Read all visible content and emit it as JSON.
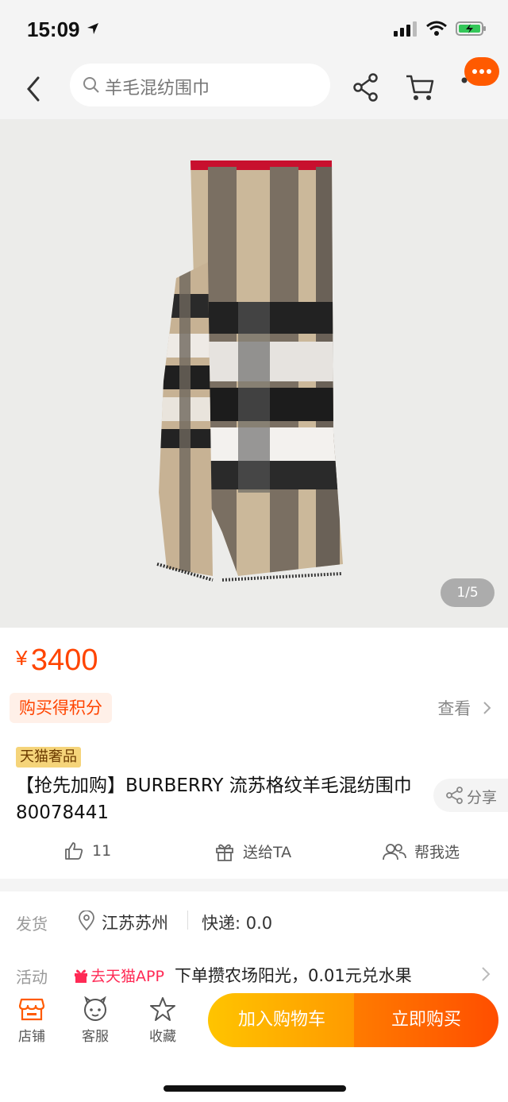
{
  "status": {
    "time": "15:09"
  },
  "search": {
    "query": "羊毛混纺围巾"
  },
  "gallery": {
    "counter": "1/5"
  },
  "price": {
    "currency": "¥",
    "amount": "3400"
  },
  "points": {
    "label": "购买得积分",
    "view": "查看"
  },
  "product": {
    "tag": "天猫奢品",
    "title": "【抢先加购】BURBERRY 流苏格纹羊毛混纺围巾 80078441",
    "share": "分享"
  },
  "actions": {
    "likes": "11",
    "gift": "送给TA",
    "help": "帮我选"
  },
  "shipping": {
    "label": "发货",
    "location": "江苏苏州",
    "fee": "快递: 0.0"
  },
  "promo": {
    "label": "活动",
    "tag": "去天猫APP",
    "text": "下单攒农场阳光，0.01元兑水果"
  },
  "bottom": {
    "store": "店铺",
    "service": "客服",
    "favorite": "收藏",
    "add_cart": "加入购物车",
    "buy_now": "立即购买"
  },
  "colors": {
    "accent": "#ff4400",
    "cart": "#ffb300",
    "buy": "#ff5a00"
  }
}
